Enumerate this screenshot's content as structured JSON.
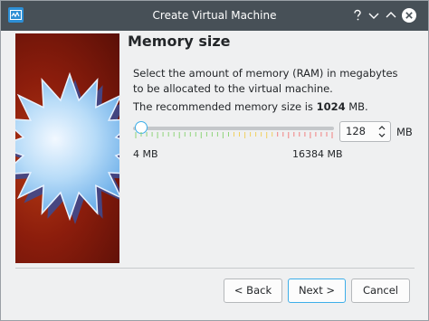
{
  "window": {
    "title": "Create Virtual Machine",
    "controls": [
      "help-icon",
      "minimize-icon",
      "maximize-icon",
      "close-icon"
    ]
  },
  "page": {
    "heading": "Memory size",
    "description": "Select the amount of memory (RAM) in megabytes to be allocated to the virtual machine.",
    "recommended_prefix": "The recommended memory size is ",
    "recommended_value": "1024",
    "recommended_suffix": " MB."
  },
  "memory": {
    "value": "128",
    "unit": "MB",
    "min_label": "4 MB",
    "max_label": "16384 MB",
    "slider_fraction": 0.0076,
    "accent_color": "#3daee9",
    "tick_colors": {
      "safe": "#8fd47a",
      "warning": "#f0d060",
      "danger": "#f08080"
    }
  },
  "buttons": {
    "back": "< Back",
    "next": "Next >",
    "cancel": "Cancel"
  }
}
